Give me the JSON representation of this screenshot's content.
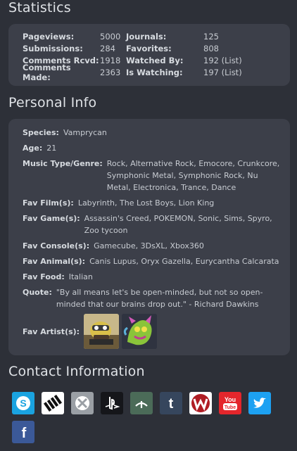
{
  "statistics": {
    "title": "Statistics",
    "rows": [
      {
        "l1": "Pageviews:",
        "v1": "5000",
        "l2": "Journals:",
        "v2": "125"
      },
      {
        "l1": "Submissions:",
        "v1": "284",
        "l2": "Favorites:",
        "v2": "808"
      },
      {
        "l1": "Comments Rcvd:",
        "v1": "1918",
        "l2": "Watched By:",
        "v2": "192 (List)"
      },
      {
        "l1": "Comments Made:",
        "v1": "2363",
        "l2": "Is Watching:",
        "v2": "197 (List)"
      }
    ]
  },
  "personal_info": {
    "title": "Personal Info",
    "species": {
      "label": "Species:",
      "value": "Vamprycan"
    },
    "age": {
      "label": "Age:",
      "value": "21"
    },
    "music": {
      "label": "Music Type/Genre:",
      "value": "Rock, Alternative Rock, Emocore, Crunkcore, Symphonic Metal, Symphonic Rock, Nu Metal, Electronica, Trance, Dance"
    },
    "films": {
      "label": "Fav Film(s):",
      "value": "Labyrinth, The Lost Boys, Lion King"
    },
    "games": {
      "label": "Fav Game(s):",
      "value": "Assassin's Creed, POKEMON, Sonic, Sims, Spyro, Zoo tycoon"
    },
    "consoles": {
      "label": "Fav Console(s):",
      "value": "Gamecube, 3DsXL, Xbox360"
    },
    "animals": {
      "label": "Fav Animal(s):",
      "value": "Canis Lupus, Oryx Gazella, Eurycantha Calcarata"
    },
    "food": {
      "label": "Fav Food:",
      "value": "Italian"
    },
    "quote": {
      "label": "Quote:",
      "value": "\"By all means let's be open-minded, but not so open-minded that our brains drop out.\" - Richard Dawkins"
    },
    "artists": {
      "label": "Fav Artist(s):"
    }
  },
  "contact": {
    "title": "Contact Information",
    "icons": [
      {
        "name": "skype",
        "color": "#1aa3e0"
      },
      {
        "name": "imvu",
        "color": "#ffffff"
      },
      {
        "name": "xbox",
        "color": "#9a9fa5"
      },
      {
        "name": "playstation",
        "color": "#15161a"
      },
      {
        "name": "deviantart",
        "color": "#4b6b58"
      },
      {
        "name": "tumblr",
        "color": "#36465d"
      },
      {
        "name": "webs",
        "color": "#ffffff"
      },
      {
        "name": "youtube",
        "color": "#e4262c"
      },
      {
        "name": "twitter",
        "color": "#1da1f2"
      },
      {
        "name": "facebook",
        "color": "#3b5998"
      }
    ]
  }
}
